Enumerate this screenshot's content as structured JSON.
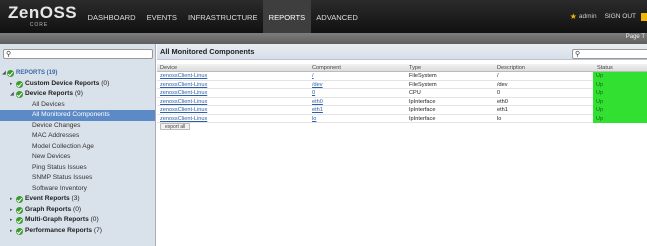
{
  "logo": {
    "main": "ZenOSS",
    "sub": "CORE"
  },
  "nav": {
    "items": [
      {
        "label": "DASHBOARD",
        "active": false
      },
      {
        "label": "EVENTS",
        "active": false
      },
      {
        "label": "INFRASTRUCTURE",
        "active": false
      },
      {
        "label": "REPORTS",
        "active": true
      },
      {
        "label": "ADVANCED",
        "active": false
      }
    ]
  },
  "user": {
    "icon": "user-icon",
    "name": "admin",
    "signout": "SIGN OUT"
  },
  "subbar": {
    "page_link": "Page T"
  },
  "tree": {
    "root": "REPORTS (19)",
    "groups_top": [
      {
        "label": "Custom Device Reports",
        "count": "(0)"
      },
      {
        "label": "Device Reports",
        "count": "(9)"
      }
    ],
    "device_reports": [
      "All Devices",
      "All Monitored Components",
      "Device Changes",
      "MAC Addresses",
      "Model Collection Age",
      "New Devices",
      "Ping Status Issues",
      "SNMP Status Issues",
      "Software Inventory"
    ],
    "groups_bottom": [
      {
        "label": "Event Reports",
        "count": "(3)"
      },
      {
        "label": "Graph Reports",
        "count": "(0)"
      },
      {
        "label": "Multi-Graph Reports",
        "count": "(0)"
      },
      {
        "label": "Performance Reports",
        "count": "(7)"
      }
    ]
  },
  "main": {
    "title": "All Monitored Components",
    "columns": [
      "Device",
      "Component",
      "Type",
      "Description",
      "Status"
    ],
    "rows": [
      {
        "device": "zenossClient-Linux",
        "component": "/",
        "type": "FileSystem",
        "description": "/",
        "status": "Up"
      },
      {
        "device": "zenossClient-Linux",
        "component": "/dev",
        "type": "FileSystem",
        "description": "/dev",
        "status": "Up"
      },
      {
        "device": "zenossClient-Linux",
        "component": "0",
        "type": "CPU",
        "description": "0",
        "status": "Up"
      },
      {
        "device": "zenossClient-Linux",
        "component": "eth0",
        "type": "IpInterface",
        "description": "eth0",
        "status": "Up"
      },
      {
        "device": "zenossClient-Linux",
        "component": "eth1",
        "type": "IpInterface",
        "description": "eth1",
        "status": "Up"
      },
      {
        "device": "zenossClient-Linux",
        "component": "lo",
        "type": "IpInterface",
        "description": "lo",
        "status": "Up"
      }
    ],
    "export_label": "export all"
  },
  "colors": {
    "status_up": "#32e032",
    "selected": "#5b8ac6",
    "check": "#3a9a2e",
    "user_icon": "#f5b400"
  }
}
